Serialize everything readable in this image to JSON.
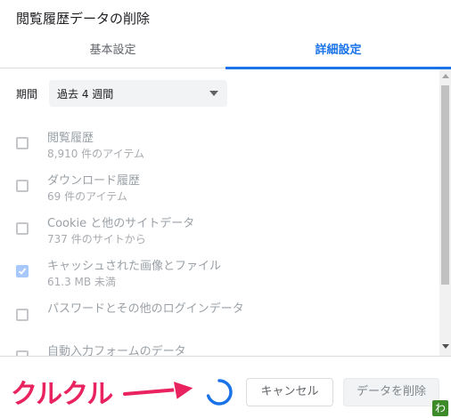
{
  "dialog": {
    "title": "閲覧履歴データの削除"
  },
  "tabs": [
    {
      "label": "基本設定",
      "active": false
    },
    {
      "label": "詳細設定",
      "active": true
    }
  ],
  "period": {
    "label": "期間",
    "value": "過去 4 週間"
  },
  "items": [
    {
      "title": "閲覧履歴",
      "subtitle": "8,910 件のアイテム",
      "checked": false
    },
    {
      "title": "ダウンロード履歴",
      "subtitle": "69 件のアイテム",
      "checked": false
    },
    {
      "title": "Cookie と他のサイトデータ",
      "subtitle": "737 件のサイトから",
      "checked": false
    },
    {
      "title": "キャッシュされた画像とファイル",
      "subtitle": "61.3 MB 未満",
      "checked": true
    },
    {
      "title": "パスワードとその他のログインデータ",
      "subtitle": "",
      "checked": false
    },
    {
      "title": "自動入力フォームのデータ",
      "subtitle": "",
      "checked": false
    }
  ],
  "buttons": {
    "cancel": "キャンセル",
    "delete": "データを削除"
  },
  "annotation": {
    "text": "クルクル",
    "color": "#e8235f"
  },
  "watermark": "わ",
  "colors": {
    "accent": "#1a73e8",
    "checkbox_checked": "#a8c7fa"
  }
}
